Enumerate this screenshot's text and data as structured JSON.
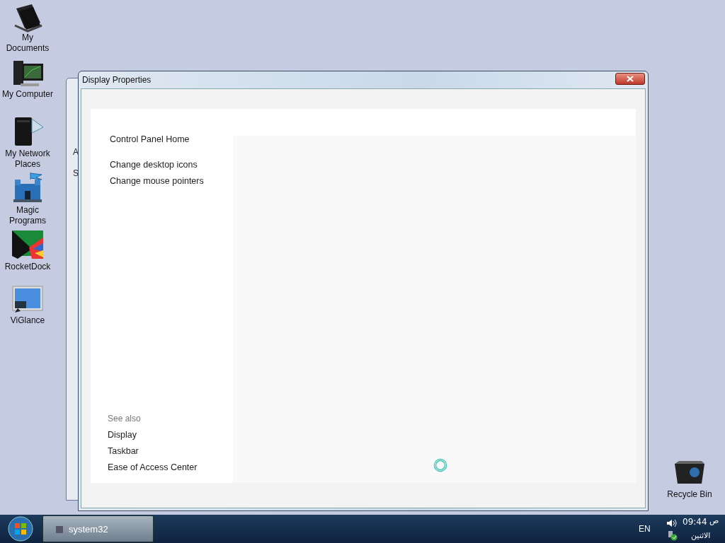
{
  "desktop_icons": [
    {
      "kind": "documents",
      "label": "My Documents"
    },
    {
      "kind": "computer",
      "label": "My Computer"
    },
    {
      "kind": "network",
      "label": "My Network Places"
    },
    {
      "kind": "castle",
      "label": "Magic Programs"
    },
    {
      "kind": "dock",
      "label": "RocketDock"
    },
    {
      "kind": "monitor",
      "label": "ViGlance"
    }
  ],
  "recycle_bin": {
    "label": "Recycle Bin"
  },
  "back_window": {
    "fragments": [
      "A",
      "S"
    ]
  },
  "window": {
    "title": "Display Properties",
    "sidebar": {
      "links": [
        "Control Panel Home"
      ],
      "tasks": [
        "Change desktop icons",
        "Change mouse pointers"
      ],
      "see_also": {
        "heading": "See also",
        "links": [
          "Display",
          "Taskbar",
          "Ease of Access Center"
        ]
      }
    }
  },
  "taskbar": {
    "buttons": [
      {
        "label": "system32",
        "selected": false
      }
    ],
    "language": "EN",
    "time": "09:44",
    "period": "ص",
    "day": "الاثنين"
  }
}
